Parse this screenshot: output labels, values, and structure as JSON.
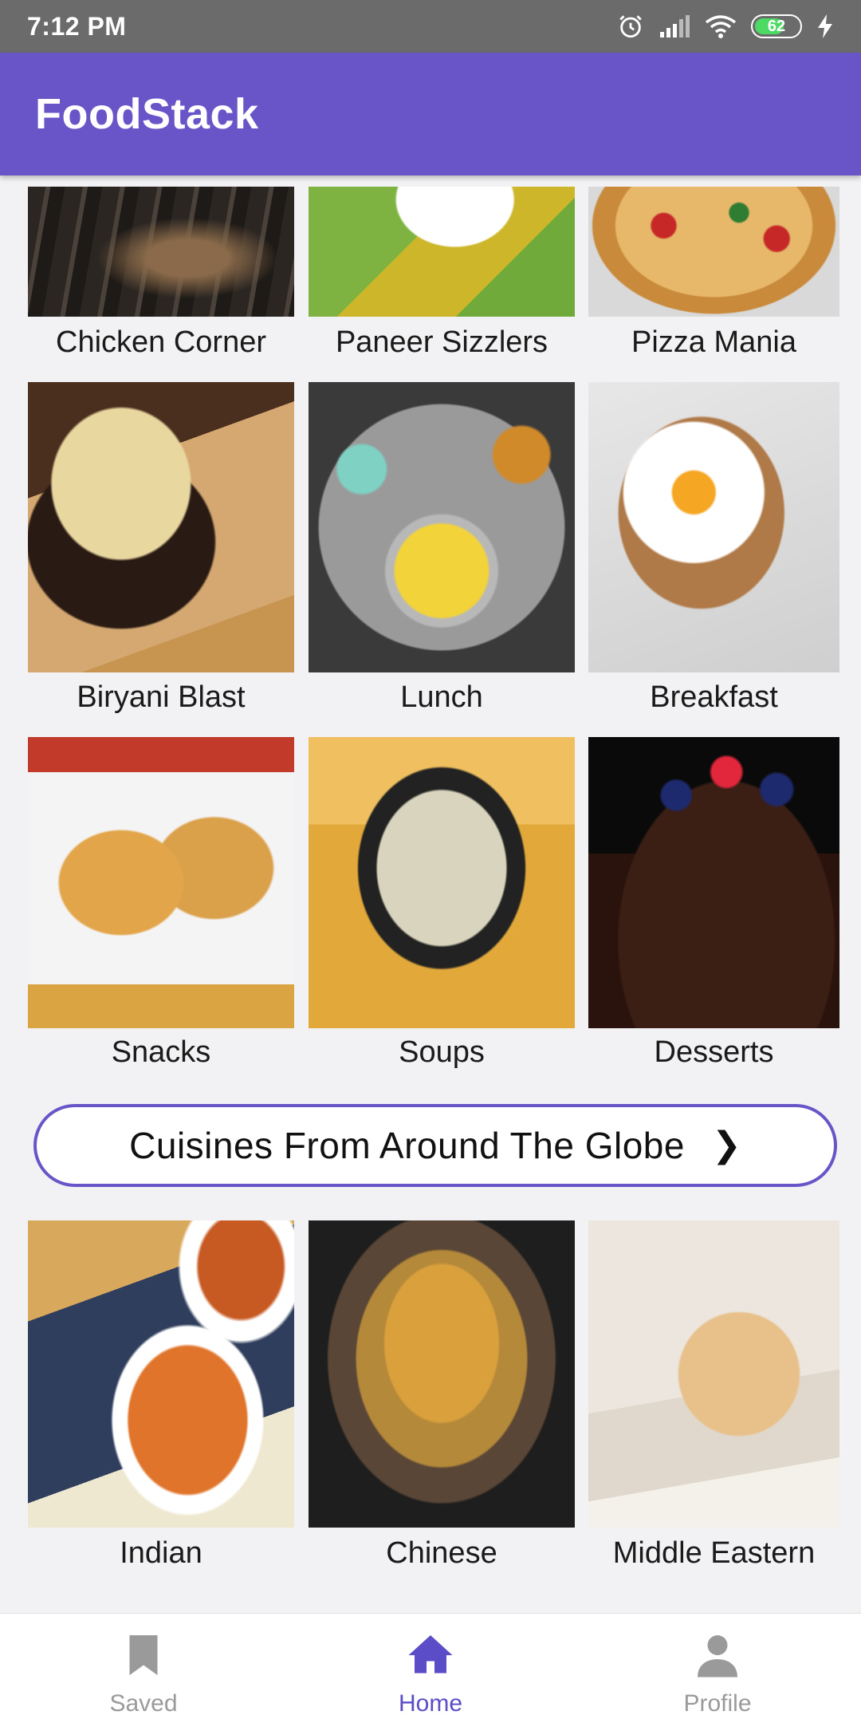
{
  "status_bar": {
    "time": "7:12 PM",
    "battery": "62",
    "icons": [
      "alarm-icon",
      "signal-icon",
      "wifi-icon",
      "battery-icon",
      "charging-icon"
    ]
  },
  "app_bar": {
    "title": "FoodStack"
  },
  "colors": {
    "primary": "#6a55c8",
    "active_nav": "#5b4cc8",
    "inactive_nav": "#9a9a9a"
  },
  "categories": [
    {
      "label": "Chicken Corner"
    },
    {
      "label": "Paneer Sizzlers"
    },
    {
      "label": "Pizza Mania"
    },
    {
      "label": "Biryani Blast"
    },
    {
      "label": "Lunch"
    },
    {
      "label": "Breakfast"
    },
    {
      "label": "Snacks"
    },
    {
      "label": "Soups"
    },
    {
      "label": "Desserts"
    }
  ],
  "globe_button": {
    "label": "Cuisines From Around The Globe"
  },
  "cuisines": [
    {
      "label": "Indian"
    },
    {
      "label": "Chinese"
    },
    {
      "label": "Middle Eastern"
    }
  ],
  "bottom_nav": {
    "items": [
      {
        "label": "Saved",
        "icon": "bookmark-icon",
        "active": false
      },
      {
        "label": "Home",
        "icon": "home-icon",
        "active": true
      },
      {
        "label": "Profile",
        "icon": "person-icon",
        "active": false
      }
    ]
  }
}
